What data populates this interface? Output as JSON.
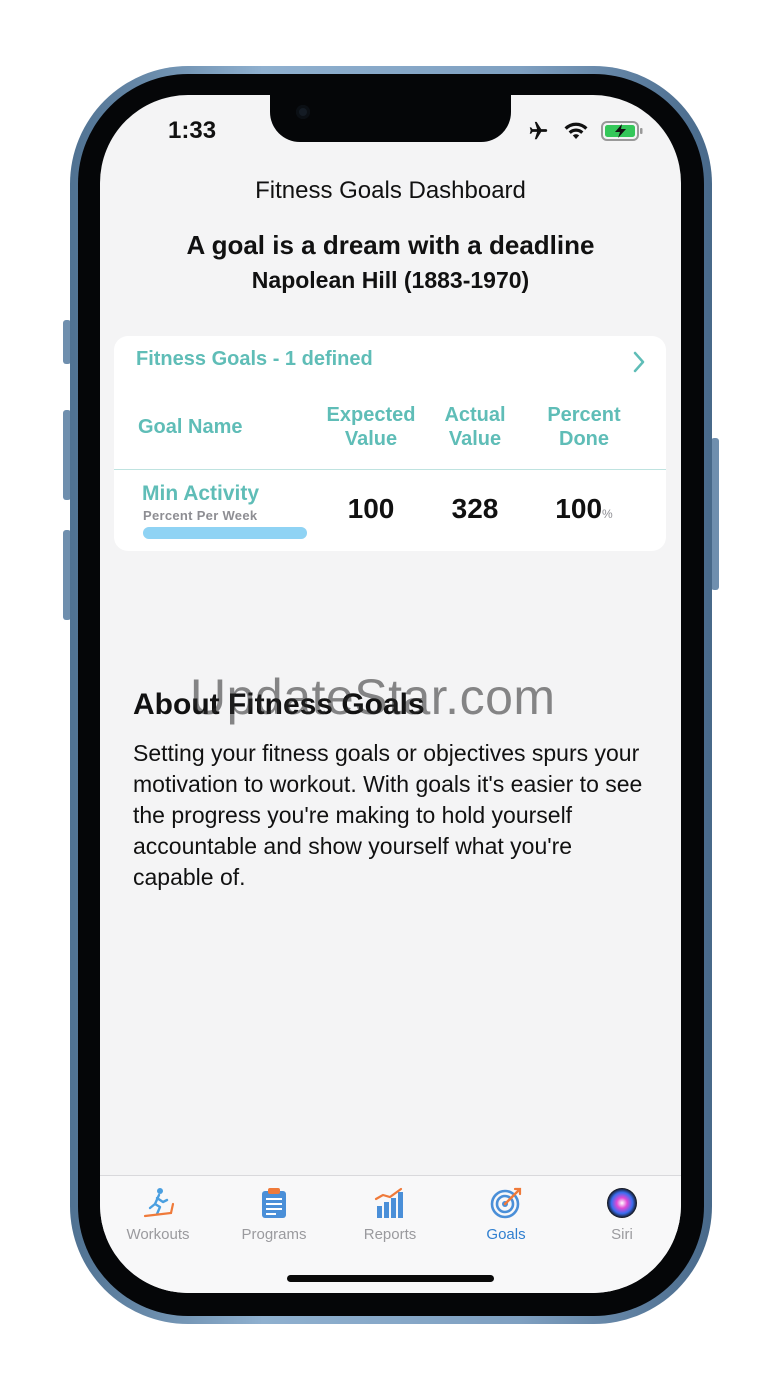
{
  "status_bar": {
    "time": "1:33",
    "icons": [
      "airplane-icon",
      "wifi-icon",
      "battery-charging-icon"
    ]
  },
  "header": {
    "title": "Fitness Goals Dashboard",
    "quote": "A goal is a dream with a deadline",
    "author": "Napolean Hill (1883-1970)"
  },
  "goals_card": {
    "heading": "Fitness Goals - 1 defined",
    "columns": {
      "name": "Goal Name",
      "expected": [
        "Expected",
        "Value"
      ],
      "actual": [
        "Actual",
        "Value"
      ],
      "percent": [
        "Percent",
        "Done"
      ]
    },
    "rows": [
      {
        "name": "Min Activity",
        "subtitle": "Percent Per Week",
        "expected": "100",
        "actual": "328",
        "percent": "100",
        "percent_unit": "%",
        "progress_fraction": 1.0
      }
    ]
  },
  "about": {
    "title": "About Fitness Goals",
    "body": "Setting your fitness goals or objectives spurs your motivation to workout. With goals it's easier to see the progress you're making to hold yourself accountable and show yourself what you're capable of."
  },
  "watermark": "UpdateStar.com",
  "tabbar": {
    "tabs": [
      {
        "label": "Workouts",
        "icon": "running-treadmill-icon"
      },
      {
        "label": "Programs",
        "icon": "clipboard-list-icon"
      },
      {
        "label": "Reports",
        "icon": "bar-chart-icon"
      },
      {
        "label": "Goals",
        "icon": "target-icon",
        "active": true
      },
      {
        "label": "Siri",
        "icon": "siri-icon"
      }
    ]
  },
  "colors": {
    "accent": "#5fbdb7",
    "active_tab": "#2f7fd0",
    "progress": "#8fd3f4"
  }
}
